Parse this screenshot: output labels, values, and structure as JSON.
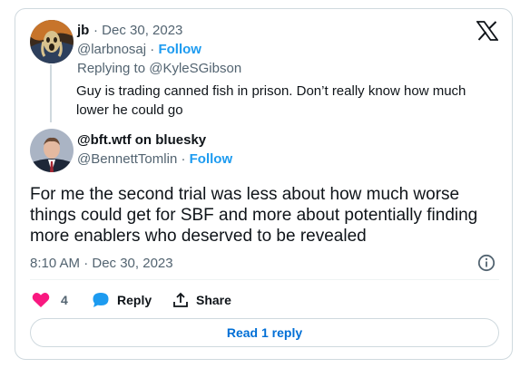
{
  "parent_tweet": {
    "display_name": "jb",
    "date": "Dec 30, 2023",
    "handle": "@larbnosaj",
    "follow_label": "Follow",
    "replying_to_prefix": "Replying to",
    "replying_to_handle": "@KyleSGibson",
    "text": "Guy is trading canned fish in prison. Don’t really know how much lower he could go"
  },
  "main_tweet": {
    "display_name": "@bft.wtf on bluesky",
    "handle": "@BennettTomlin",
    "follow_label": "Follow",
    "text": "For me the second trial was less about how much worse things could get for SBF and more about potentially finding more enablers who deserved to be revealed",
    "timestamp": "8:10 AM · Dec 30, 2023"
  },
  "actions": {
    "like_count": "4",
    "reply_label": "Reply",
    "share_label": "Share"
  },
  "read_replies_label": "Read 1 reply",
  "colors": {
    "accent": "#1d9bf0",
    "like": "#f91880",
    "link": "#006fd6",
    "muted": "#536471"
  },
  "icons": [
    "x-logo-icon",
    "info-icon",
    "heart-icon",
    "reply-bubble-icon",
    "share-icon"
  ]
}
